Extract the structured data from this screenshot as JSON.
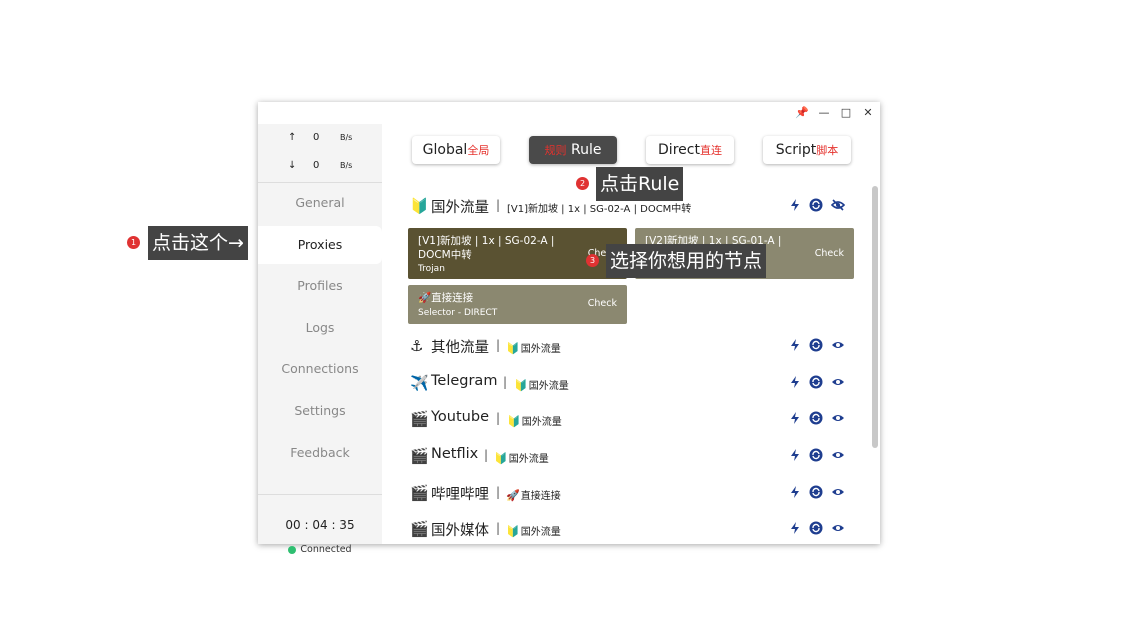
{
  "titlebar": {
    "pin": "📌",
    "minimize": "—",
    "maximize": "□",
    "close": "✕"
  },
  "traffic": {
    "up_arrow": "↑",
    "up_value": "0",
    "up_unit": "B/s",
    "down_arrow": "↓",
    "down_value": "0",
    "down_unit": "B/s"
  },
  "nav": {
    "general": "General",
    "proxies": "Proxies",
    "profiles": "Profiles",
    "logs": "Logs",
    "connections": "Connections",
    "settings": "Settings",
    "feedback": "Feedback"
  },
  "status": {
    "timer": "00 : 04 : 35",
    "connection": "Connected"
  },
  "modes": {
    "global": {
      "en": "Global",
      "cn": "全局"
    },
    "rule": {
      "cn": "规则",
      "en": "Rule"
    },
    "direct": {
      "en": "Direct",
      "cn": "直连"
    },
    "script": {
      "en": "Script",
      "cn": "脚本"
    }
  },
  "groups": [
    {
      "emoji": "🔰",
      "name": "国外流量",
      "sep": "|",
      "selected": "[V1]新加坡 | 1x | SG-02-A | DOCM中转",
      "selected_emoji": ""
    },
    {
      "emoji": "⚓",
      "name": "其他流量",
      "sep": "|",
      "selected": "国外流量",
      "selected_emoji": "🔰"
    },
    {
      "emoji": "✈️",
      "name": "Telegram",
      "sep": "|",
      "selected": "国外流量",
      "selected_emoji": "🔰"
    },
    {
      "emoji": "🎬",
      "name": "Youtube",
      "sep": "|",
      "selected": "国外流量",
      "selected_emoji": "🔰"
    },
    {
      "emoji": "🎬",
      "name": "Netflix",
      "sep": "|",
      "selected": "国外流量",
      "selected_emoji": "🔰"
    },
    {
      "emoji": "🎬",
      "name": "哔哩哔哩",
      "sep": "|",
      "selected": "直接连接",
      "selected_emoji": "🚀"
    },
    {
      "emoji": "🎬",
      "name": "国外媒体",
      "sep": "|",
      "selected": "国外流量",
      "selected_emoji": "🔰"
    }
  ],
  "proxies": [
    {
      "name": "[V1]新加坡 | 1x | SG-02-A | DOCM中转",
      "type": "Trojan",
      "check": "Check"
    },
    {
      "name": "[V2]新加坡 | 1x | SG-01-A | DOCM中转",
      "type": "",
      "check": "Check"
    },
    {
      "name": "🚀直接连接",
      "type": "Selector - DIRECT",
      "check": "Check"
    }
  ],
  "icons": {
    "latency": "lightning-icon",
    "refresh": "refresh-icon",
    "visible": "eye-icon",
    "hidden": "eye-off-icon"
  },
  "colors": {
    "card_selected": "#5a5232",
    "card_default": "#8b8870",
    "icon_blue": "#1e3d8f",
    "connected": "#2fbf71",
    "badge": "#e03232",
    "accent_red": "#e5322d"
  },
  "annotations": {
    "step1": {
      "num": "1",
      "text": "点击这个→"
    },
    "step2": {
      "num": "2",
      "text": "点击Rule"
    },
    "step3": {
      "num": "3",
      "text": "选择你想用的节点"
    }
  }
}
